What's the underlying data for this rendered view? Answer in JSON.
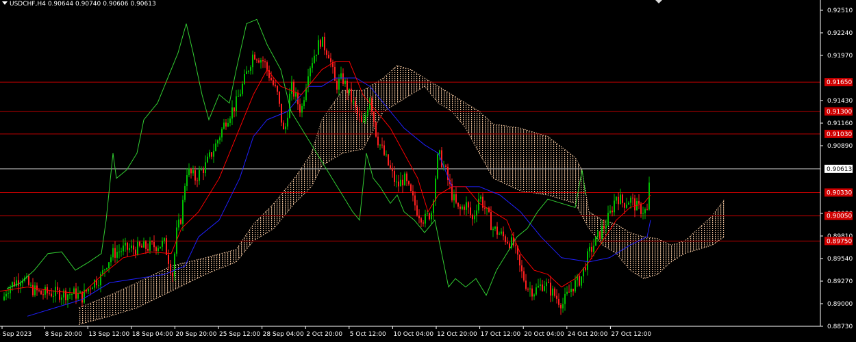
{
  "header": {
    "symbol": "USDCHF,H4",
    "open": "0.90644",
    "high": "0.90740",
    "low": "0.90606",
    "close": "0.90613"
  },
  "chart_data": {
    "type": "candlestick",
    "symbol": "USDCHF",
    "timeframe": "H4",
    "ylim": [
      0.8873,
      0.9251
    ],
    "y_ticks": [
      "0.92510",
      "0.92240",
      "0.91970",
      "0.91430",
      "0.91160",
      "0.90890",
      "0.90080",
      "0.89810",
      "0.89540",
      "0.89270",
      "0.89000",
      "0.88730"
    ],
    "x_ticks": [
      "6 Sep 2023",
      "8 Sep 20:00",
      "13 Sep 12:00",
      "18 Sep 04:00",
      "20 Sep 20:00",
      "25 Sep 12:00",
      "28 Sep 04:00",
      "2 Oct 20:00",
      "5 Oct 12:00",
      "10 Oct 04:00",
      "12 Oct 20:00",
      "17 Oct 12:00",
      "20 Oct 04:00",
      "24 Oct 20:00",
      "27 Oct 12:00"
    ],
    "current_price": {
      "value": 0.90613,
      "label": "0.90613"
    },
    "horizontal_levels": [
      {
        "value": 0.9165,
        "label": "0.91650"
      },
      {
        "value": 0.913,
        "label": "0.91300"
      },
      {
        "value": 0.9103,
        "label": "0.91030"
      },
      {
        "value": 0.9033,
        "label": "0.90330"
      },
      {
        "value": 0.9005,
        "label": "0.90050"
      },
      {
        "value": 0.8975,
        "label": "0.89750"
      }
    ],
    "close_path": [
      [
        0,
        0.8895
      ],
      [
        10,
        0.8918
      ],
      [
        22,
        0.8926
      ],
      [
        33,
        0.8932
      ],
      [
        45,
        0.8918
      ],
      [
        60,
        0.8912
      ],
      [
        75,
        0.8913
      ],
      [
        90,
        0.8912
      ],
      [
        110,
        0.8912
      ],
      [
        120,
        0.8908
      ],
      [
        135,
        0.8925
      ],
      [
        148,
        0.8932
      ],
      [
        155,
        0.8948
      ],
      [
        165,
        0.896
      ],
      [
        180,
        0.8965
      ],
      [
        200,
        0.8966
      ],
      [
        220,
        0.8968
      ],
      [
        240,
        0.8972
      ],
      [
        252,
        0.8935
      ],
      [
        258,
        0.8985
      ],
      [
        265,
        0.9005
      ],
      [
        272,
        0.906
      ],
      [
        285,
        0.905
      ],
      [
        300,
        0.9065
      ],
      [
        315,
        0.909
      ],
      [
        330,
        0.912
      ],
      [
        345,
        0.914
      ],
      [
        358,
        0.917
      ],
      [
        370,
        0.92
      ],
      [
        385,
        0.919
      ],
      [
        395,
        0.917
      ],
      [
        405,
        0.915
      ],
      [
        415,
        0.91
      ],
      [
        425,
        0.916
      ],
      [
        440,
        0.913
      ],
      [
        450,
        0.918
      ],
      [
        460,
        0.92
      ],
      [
        468,
        0.9215
      ],
      [
        480,
        0.92
      ],
      [
        490,
        0.916
      ],
      [
        500,
        0.917
      ],
      [
        510,
        0.915
      ],
      [
        520,
        0.913
      ],
      [
        530,
        0.911
      ],
      [
        540,
        0.915
      ],
      [
        550,
        0.91
      ],
      [
        560,
        0.908
      ],
      [
        570,
        0.906
      ],
      [
        580,
        0.904
      ],
      [
        590,
        0.905
      ],
      [
        600,
        0.903
      ],
      [
        610,
        0.901
      ],
      [
        620,
        0.9
      ],
      [
        630,
        0.901
      ],
      [
        640,
        0.908
      ],
      [
        650,
        0.906
      ],
      [
        660,
        0.903
      ],
      [
        670,
        0.901
      ],
      [
        680,
        0.902
      ],
      [
        690,
        0.9
      ],
      [
        700,
        0.903
      ],
      [
        710,
        0.901
      ],
      [
        720,
        0.899
      ],
      [
        735,
        0.898
      ],
      [
        750,
        0.897
      ],
      [
        760,
        0.894
      ],
      [
        770,
        0.892
      ],
      [
        780,
        0.8915
      ],
      [
        795,
        0.8925
      ],
      [
        805,
        0.8915
      ],
      [
        815,
        0.8905
      ],
      [
        822,
        0.89
      ],
      [
        835,
        0.892
      ],
      [
        848,
        0.893
      ],
      [
        860,
        0.896
      ],
      [
        870,
        0.8975
      ],
      [
        880,
        0.899
      ],
      [
        890,
        0.9005
      ],
      [
        900,
        0.903
      ],
      [
        910,
        0.902
      ],
      [
        920,
        0.9025
      ],
      [
        930,
        0.9015
      ],
      [
        945,
        0.901
      ],
      [
        950,
        0.9061
      ]
    ],
    "tenkan_path": [
      [
        0,
        0.8915
      ],
      [
        40,
        0.892
      ],
      [
        80,
        0.8915
      ],
      [
        120,
        0.8912
      ],
      [
        150,
        0.8935
      ],
      [
        180,
        0.8955
      ],
      [
        220,
        0.8962
      ],
      [
        250,
        0.896
      ],
      [
        265,
        0.899
      ],
      [
        290,
        0.901
      ],
      [
        320,
        0.905
      ],
      [
        350,
        0.911
      ],
      [
        370,
        0.915
      ],
      [
        390,
        0.918
      ],
      [
        410,
        0.916
      ],
      [
        440,
        0.915
      ],
      [
        470,
        0.918
      ],
      [
        490,
        0.919
      ],
      [
        510,
        0.919
      ],
      [
        530,
        0.915
      ],
      [
        550,
        0.913
      ],
      [
        570,
        0.911
      ],
      [
        590,
        0.908
      ],
      [
        610,
        0.905
      ],
      [
        625,
        0.901
      ],
      [
        640,
        0.903
      ],
      [
        660,
        0.904
      ],
      [
        680,
        0.904
      ],
      [
        700,
        0.902
      ],
      [
        720,
        0.901
      ],
      [
        740,
        0.9
      ],
      [
        760,
        0.896
      ],
      [
        780,
        0.894
      ],
      [
        800,
        0.8935
      ],
      [
        820,
        0.892
      ],
      [
        840,
        0.893
      ],
      [
        860,
        0.895
      ],
      [
        880,
        0.8975
      ],
      [
        900,
        0.9
      ],
      [
        920,
        0.9015
      ],
      [
        940,
        0.902
      ],
      [
        950,
        0.903
      ]
    ],
    "kijun_path": [
      [
        40,
        0.8885
      ],
      [
        80,
        0.8895
      ],
      [
        120,
        0.8905
      ],
      [
        160,
        0.8925
      ],
      [
        200,
        0.893
      ],
      [
        240,
        0.8935
      ],
      [
        270,
        0.8945
      ],
      [
        290,
        0.898
      ],
      [
        320,
        0.9
      ],
      [
        350,
        0.905
      ],
      [
        370,
        0.91
      ],
      [
        390,
        0.912
      ],
      [
        420,
        0.913
      ],
      [
        450,
        0.916
      ],
      [
        470,
        0.916
      ],
      [
        490,
        0.917
      ],
      [
        520,
        0.917
      ],
      [
        540,
        0.916
      ],
      [
        560,
        0.914
      ],
      [
        590,
        0.911
      ],
      [
        620,
        0.909
      ],
      [
        640,
        0.908
      ],
      [
        660,
        0.904
      ],
      [
        700,
        0.904
      ],
      [
        730,
        0.903
      ],
      [
        760,
        0.901
      ],
      [
        790,
        0.898
      ],
      [
        820,
        0.8955
      ],
      [
        860,
        0.895
      ],
      [
        890,
        0.8955
      ],
      [
        920,
        0.897
      ],
      [
        945,
        0.898
      ],
      [
        950,
        0.9
      ]
    ],
    "chikou_path": [
      [
        10,
        0.8918
      ],
      [
        30,
        0.8925
      ],
      [
        50,
        0.894
      ],
      [
        70,
        0.896
      ],
      [
        90,
        0.8962
      ],
      [
        110,
        0.894
      ],
      [
        130,
        0.895
      ],
      [
        148,
        0.896
      ],
      [
        155,
        0.9
      ],
      [
        165,
        0.908
      ],
      [
        170,
        0.905
      ],
      [
        185,
        0.906
      ],
      [
        200,
        0.908
      ],
      [
        210,
        0.912
      ],
      [
        230,
        0.914
      ],
      [
        245,
        0.917
      ],
      [
        260,
        0.92
      ],
      [
        272,
        0.9235
      ],
      [
        282,
        0.92
      ],
      [
        295,
        0.915
      ],
      [
        305,
        0.912
      ],
      [
        320,
        0.915
      ],
      [
        335,
        0.914
      ],
      [
        345,
        0.918
      ],
      [
        360,
        0.9235
      ],
      [
        375,
        0.924
      ],
      [
        390,
        0.921
      ],
      [
        410,
        0.918
      ],
      [
        425,
        0.913
      ],
      [
        440,
        0.911
      ],
      [
        455,
        0.909
      ],
      [
        470,
        0.907
      ],
      [
        485,
        0.905
      ],
      [
        500,
        0.903
      ],
      [
        515,
        0.901
      ],
      [
        525,
        0.9
      ],
      [
        535,
        0.908
      ],
      [
        545,
        0.905
      ],
      [
        555,
        0.904
      ],
      [
        570,
        0.902
      ],
      [
        580,
        0.903
      ],
      [
        590,
        0.901
      ],
      [
        605,
        0.9
      ],
      [
        620,
        0.8985
      ],
      [
        635,
        0.9
      ],
      [
        645,
        0.896
      ],
      [
        655,
        0.892
      ],
      [
        665,
        0.893
      ],
      [
        680,
        0.892
      ],
      [
        695,
        0.893
      ],
      [
        710,
        0.891
      ],
      [
        725,
        0.894
      ],
      [
        740,
        0.896
      ],
      [
        755,
        0.898
      ],
      [
        770,
        0.899
      ],
      [
        785,
        0.901
      ],
      [
        800,
        0.9025
      ],
      [
        820,
        0.902
      ],
      [
        840,
        0.9015
      ],
      [
        850,
        0.906
      ],
      [
        855,
        0.903
      ]
    ],
    "cloud_upper": [
      [
        115,
        0.8895
      ],
      [
        160,
        0.891
      ],
      [
        200,
        0.8925
      ],
      [
        250,
        0.8945
      ],
      [
        300,
        0.8955
      ],
      [
        345,
        0.8965
      ],
      [
        370,
        0.8995
      ],
      [
        400,
        0.902
      ],
      [
        430,
        0.905
      ],
      [
        455,
        0.908
      ],
      [
        470,
        0.912
      ],
      [
        500,
        0.9155
      ],
      [
        530,
        0.9155
      ],
      [
        560,
        0.917
      ],
      [
        580,
        0.9185
      ],
      [
        600,
        0.918
      ],
      [
        620,
        0.917
      ],
      [
        640,
        0.916
      ],
      [
        660,
        0.915
      ],
      [
        680,
        0.914
      ],
      [
        700,
        0.913
      ],
      [
        720,
        0.9115
      ],
      [
        760,
        0.911
      ],
      [
        800,
        0.91
      ],
      [
        840,
        0.9075
      ],
      [
        850,
        0.906
      ],
      [
        860,
        0.901
      ],
      [
        880,
        0.9
      ],
      [
        900,
        0.8995
      ],
      [
        920,
        0.8985
      ],
      [
        940,
        0.898
      ],
      [
        960,
        0.8978
      ],
      [
        980,
        0.897
      ],
      [
        1000,
        0.8975
      ],
      [
        1020,
        0.899
      ],
      [
        1040,
        0.9005
      ],
      [
        1058,
        0.9025
      ]
    ],
    "cloud_lower": [
      [
        115,
        0.8875
      ],
      [
        160,
        0.8885
      ],
      [
        200,
        0.8895
      ],
      [
        250,
        0.8915
      ],
      [
        300,
        0.8935
      ],
      [
        345,
        0.895
      ],
      [
        370,
        0.8975
      ],
      [
        400,
        0.899
      ],
      [
        430,
        0.902
      ],
      [
        455,
        0.904
      ],
      [
        470,
        0.9065
      ],
      [
        500,
        0.908
      ],
      [
        530,
        0.9085
      ],
      [
        560,
        0.913
      ],
      [
        580,
        0.914
      ],
      [
        600,
        0.915
      ],
      [
        620,
        0.916
      ],
      [
        640,
        0.914
      ],
      [
        660,
        0.913
      ],
      [
        680,
        0.911
      ],
      [
        700,
        0.908
      ],
      [
        720,
        0.905
      ],
      [
        760,
        0.9035
      ],
      [
        800,
        0.903
      ],
      [
        840,
        0.902
      ],
      [
        860,
        0.899
      ],
      [
        880,
        0.897
      ],
      [
        900,
        0.896
      ],
      [
        920,
        0.894
      ],
      [
        940,
        0.893
      ],
      [
        960,
        0.8935
      ],
      [
        980,
        0.895
      ],
      [
        1000,
        0.896
      ],
      [
        1020,
        0.8965
      ],
      [
        1040,
        0.897
      ],
      [
        1058,
        0.898
      ]
    ],
    "colors": {
      "background": "#000000",
      "bull_candle": "#00c000",
      "bear_candle": "#ff2020",
      "tenkan": "#ff0000",
      "kijun": "#2020ff",
      "chikou": "#32cd32",
      "cloud": "#f5c8a0",
      "level_line": "#c00000",
      "level_label_bg": "#d00000",
      "price_line": "#c8c8c8",
      "axis": "#ffffff"
    }
  }
}
